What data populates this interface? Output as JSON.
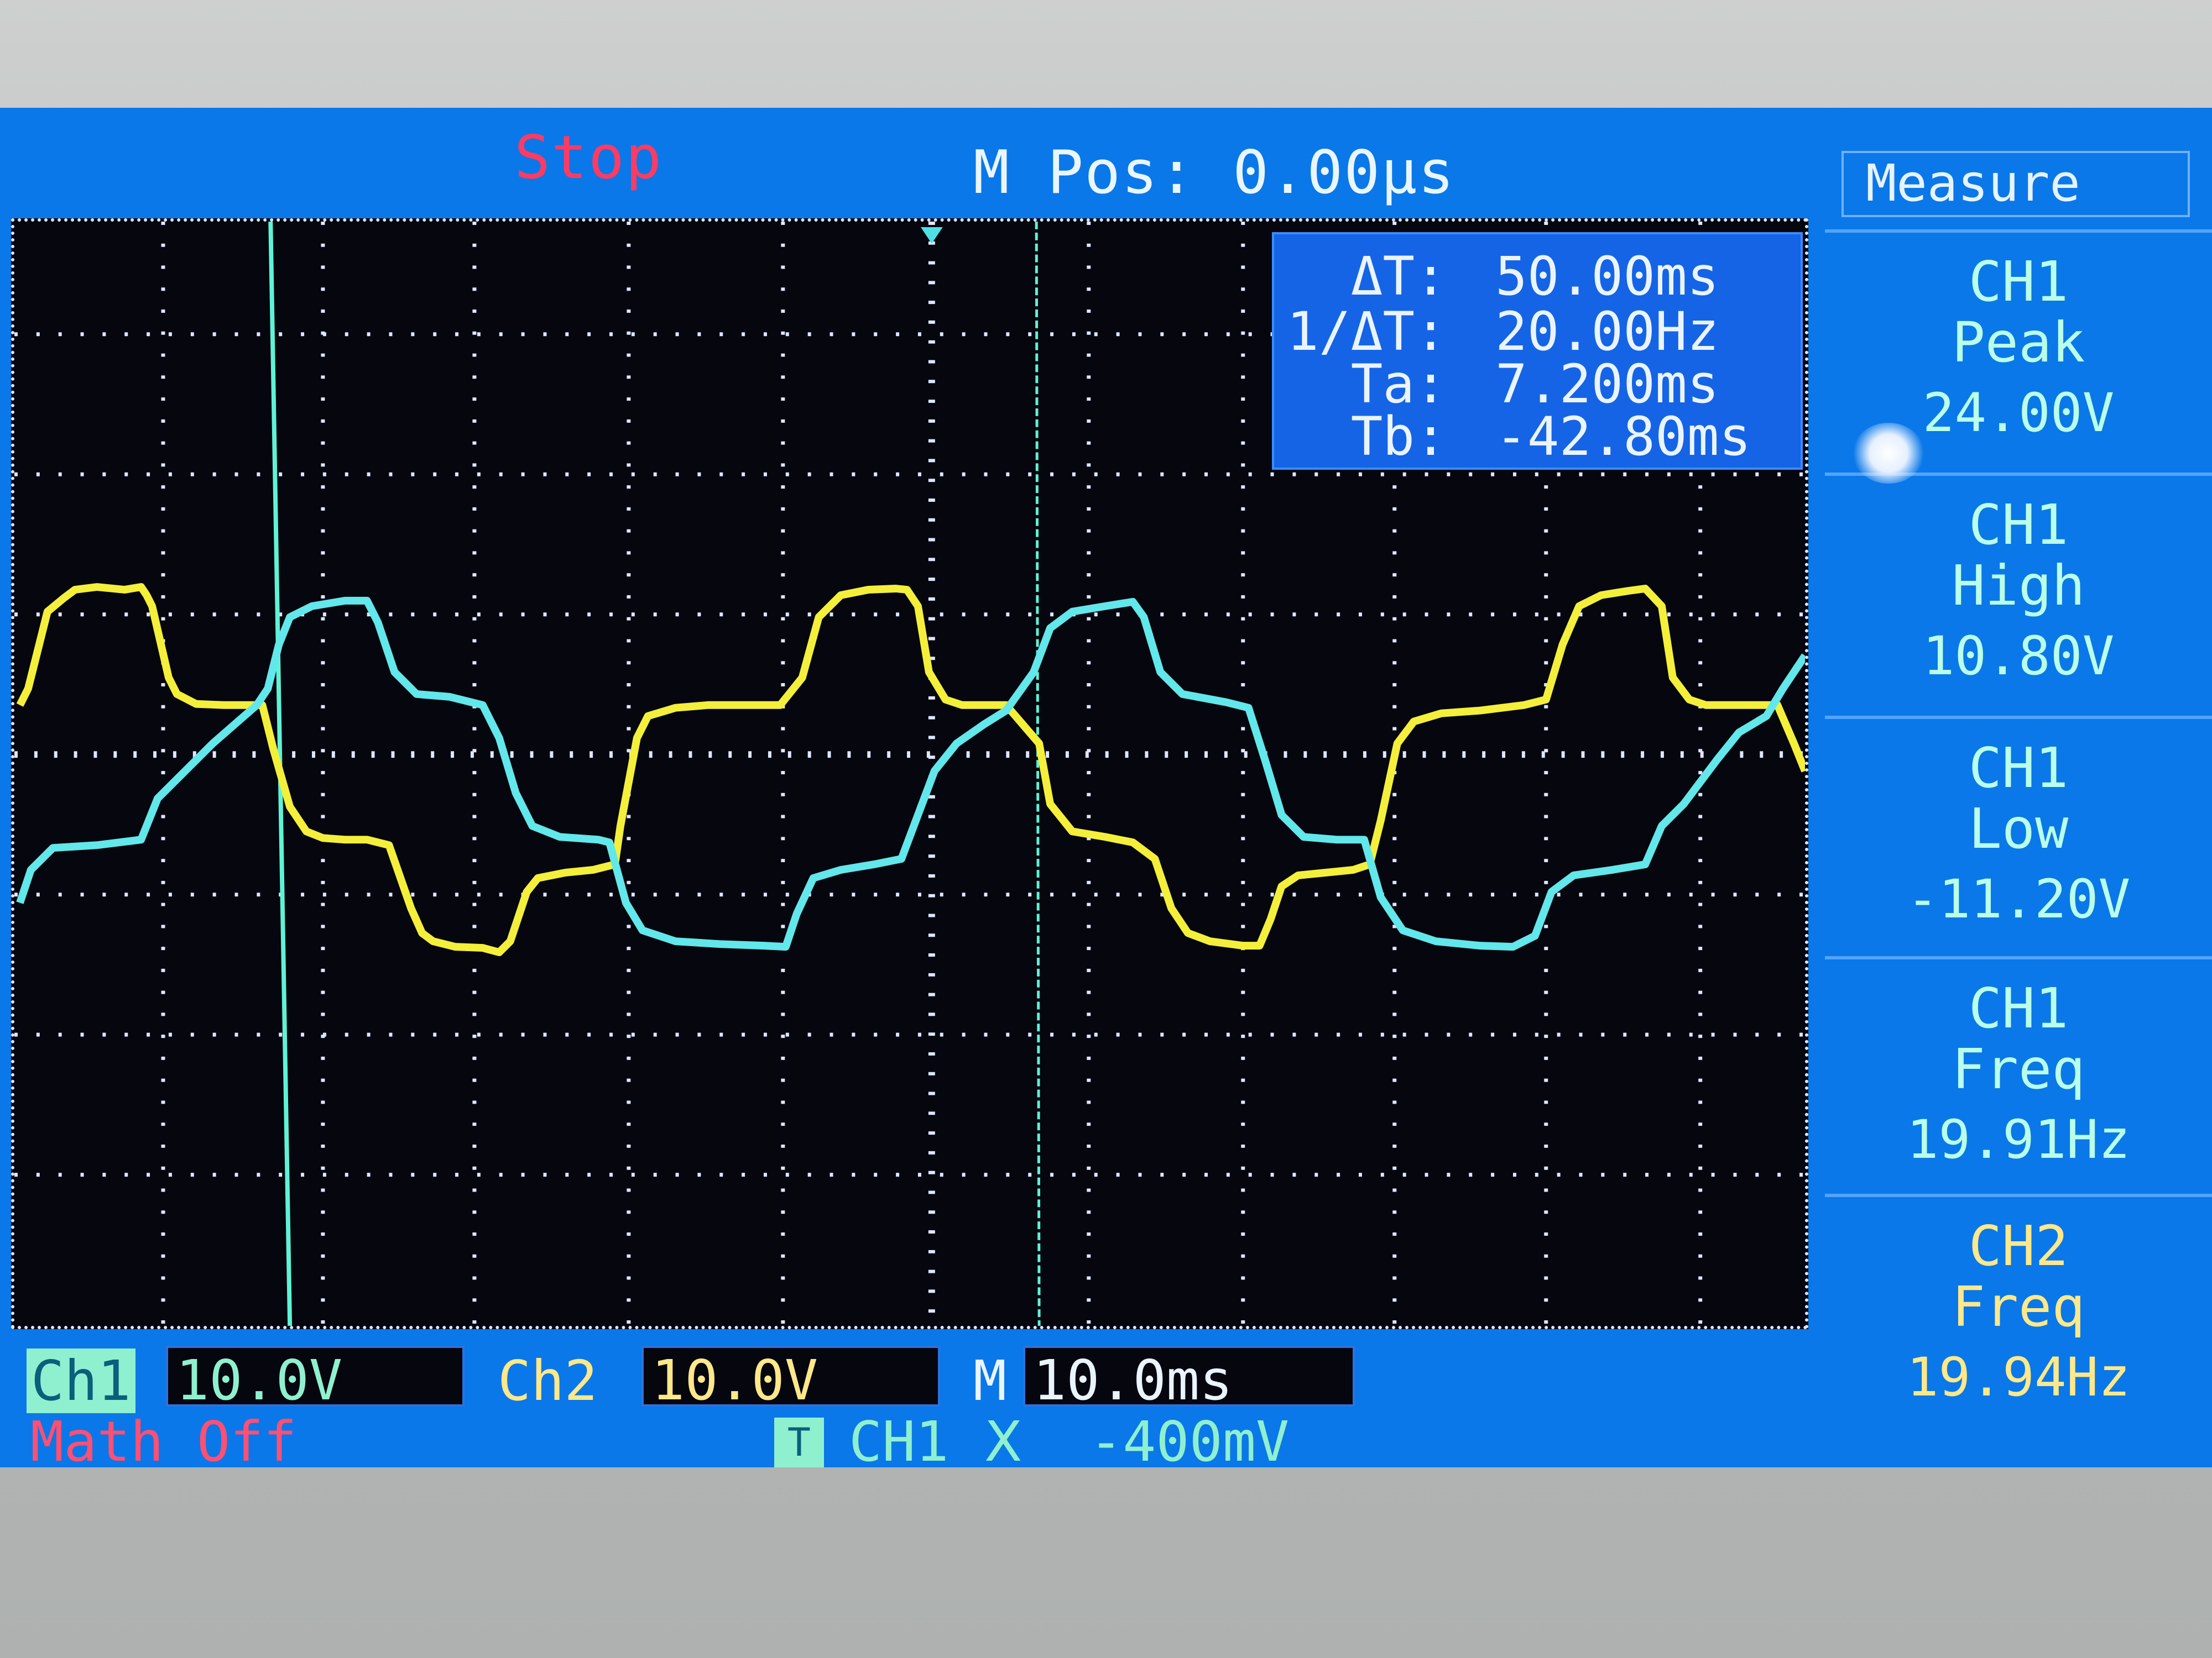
{
  "header": {
    "status": "Stop",
    "m_pos": "M Pos: 0.00µs"
  },
  "cursors": {
    "rows": [
      {
        "key": "ΔT:",
        "value": "50.00ms"
      },
      {
        "key": "1/ΔT:",
        "value": "20.00Hz"
      },
      {
        "key": "Ta:",
        "value": "7.200ms"
      },
      {
        "key": "Tb:",
        "value": "-42.80ms"
      }
    ]
  },
  "measure": {
    "title": "Measure",
    "items": [
      {
        "source": "CH1",
        "type": "Peak",
        "value": "24.00V"
      },
      {
        "source": "CH1",
        "type": "High",
        "value": "10.80V"
      },
      {
        "source": "CH1",
        "type": "Low",
        "value": "-11.20V"
      },
      {
        "source": "CH1",
        "type": "Freq",
        "value": "19.91Hz"
      },
      {
        "source": "CH2",
        "type": "Freq",
        "value": "19.94Hz"
      }
    ]
  },
  "status_bar": {
    "ch1_label": "Ch1",
    "ch1_scale": "10.0V",
    "ch2_label": "Ch2",
    "ch2_scale": "10.0V",
    "timebase_label": "M",
    "timebase_scale": "10.0ms",
    "math": "Math Off",
    "trigger_icon": "T",
    "trigger_source": "CH1",
    "trigger_edge": "Ⅹ",
    "trigger_level": "-400mV"
  },
  "colors": {
    "screen_bg": "#0a78e8",
    "ch1": "#f4ef3a",
    "ch2": "#62e7ea",
    "cursor": "#5ff2d6",
    "stop": "#ff3b63"
  },
  "icons": {
    "trigger": "trigger-t-icon",
    "knob": "selector-knob-icon"
  }
}
